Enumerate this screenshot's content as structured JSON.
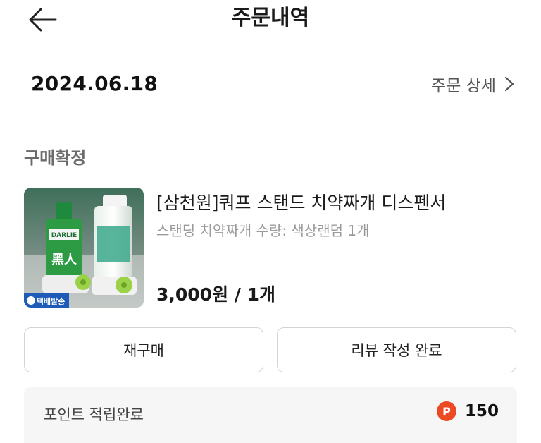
{
  "header": {
    "title": "주문내역",
    "back_icon": "arrow-left-icon"
  },
  "order": {
    "date": "2024.06.18",
    "detail_link": "주문 상세",
    "detail_icon": "chevron-right-icon"
  },
  "status": "구매확정",
  "product": {
    "name": "[삼천원]쿼프 스탠드 치약짜개 디스펜서",
    "option": "스탠딩 치약짜개 수량: 색상랜덤 1개",
    "price": "3,000원 / 1개",
    "image_badge": "택배발송",
    "tube_label": "DARLIE",
    "tube_text": "黑人"
  },
  "actions": {
    "rebuy": "재구매",
    "review": "리뷰 작성 완료"
  },
  "points": {
    "label": "포인트 적립완료",
    "badge": "P",
    "amount": "150",
    "accent": "#ec4a23"
  }
}
